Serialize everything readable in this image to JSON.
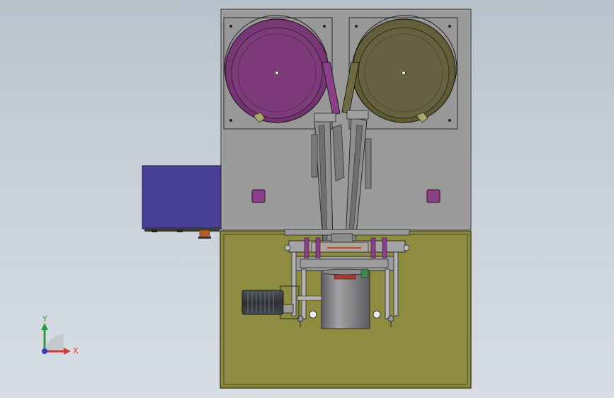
{
  "triad": {
    "x_label": "X",
    "y_label": "Y",
    "x_color": "#d23a3a",
    "y_color": "#2c9a3b",
    "z_color": "#2f3fd0"
  },
  "colors": {
    "frame": "#9a9a9a",
    "bowl_left": "#8a3f86",
    "bowl_right": "#6f6a43",
    "control_box": "#4a3f96",
    "base_plate": "#8b8a3f",
    "motor": "#3a3e44",
    "drum": "#7a7a7c",
    "accent_purple": "#8a3f86"
  },
  "icons": {
    "left_bowl": "vibratory-bowl-icon",
    "right_bowl": "vibratory-bowl-icon",
    "motor": "motor-icon"
  }
}
